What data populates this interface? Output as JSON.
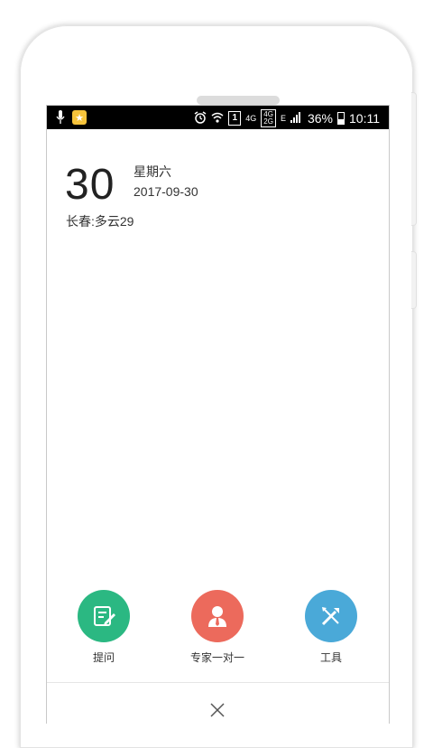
{
  "status_bar": {
    "network": "4G",
    "sim": "1",
    "lte": "E",
    "battery": "36%",
    "time": "10:11"
  },
  "calendar": {
    "day": "30",
    "weekday": "星期六",
    "date": "2017-09-30"
  },
  "weather": {
    "text": "长春:多云29"
  },
  "actions": [
    {
      "label": "提问",
      "color": "#2bb882",
      "icon": "edit-icon"
    },
    {
      "label": "专家一对一",
      "color": "#ec6a5c",
      "icon": "expert-icon"
    },
    {
      "label": "工具",
      "color": "#4aa9d8",
      "icon": "tools-icon"
    }
  ],
  "colors": {
    "statusbar": "#000000",
    "text": "#333333"
  },
  "close_icon": "close-icon"
}
